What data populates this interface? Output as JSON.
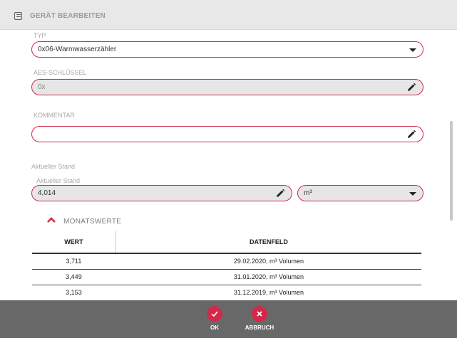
{
  "header": {
    "title": "GERÄT BEARBEITEN",
    "icon": "document-icon"
  },
  "typ": {
    "label": "TYP",
    "value": "0x06-Warmwasserzähler"
  },
  "aes": {
    "label": "AES-SCHLÜSSEL",
    "value": "0x"
  },
  "kommentar": {
    "label": "KOMMENTAR",
    "value": ""
  },
  "stand": {
    "section_label": "Aktueller Stand",
    "label": "Aktueller Stand",
    "value": "4,014",
    "unit": "m³"
  },
  "monatswerte": {
    "title": "MONATSWERTE",
    "columns": [
      "WERT",
      "DATENFELD"
    ],
    "rows": [
      {
        "wert": "3,711",
        "datenfeld": "29.02.2020, m³ Volumen"
      },
      {
        "wert": "3,449",
        "datenfeld": "31.01.2020, m³ Volumen"
      },
      {
        "wert": "3,153",
        "datenfeld": "31.12.2019, m³ Volumen"
      }
    ]
  },
  "footer": {
    "ok_label": "OK",
    "cancel_label": "ABBRUCH"
  },
  "colors": {
    "accent": "#d42849",
    "footer_bg": "#686868",
    "header_bg": "#e8e8e8"
  }
}
